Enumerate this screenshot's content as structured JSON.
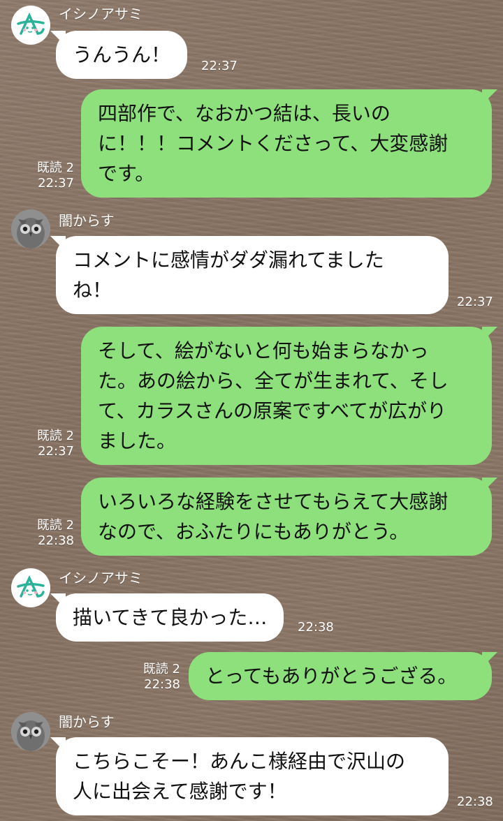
{
  "icons": {
    "avatar_ishino": "letter-a-face-avatar-icon",
    "avatar_karasu": "owl-photo-avatar-icon"
  },
  "colors": {
    "outgoing_bubble": "#8de07b",
    "incoming_bubble": "#ffffff",
    "background": "#857060"
  },
  "messages": [
    {
      "direction": "in",
      "sender": "イシノアサミ",
      "text": "うんうん！",
      "time": "22:37"
    },
    {
      "direction": "out",
      "read": "既読 2",
      "text": "四部作で、なおかつ結は、長いの\nに！！！コメントくださって、大変感謝\nです。",
      "time": "22:37"
    },
    {
      "direction": "in",
      "sender": "闇からす",
      "text": "コメントに感情がダダ漏れてました\nね！",
      "time": "22:37"
    },
    {
      "direction": "out",
      "read": "既読 2",
      "text": "そして、絵がないと何も始まらなかっ\nた。あの絵から、全てが生まれて、そし\nて、カラスさんの原案ですべてが広がり\nました。",
      "time": "22:37"
    },
    {
      "direction": "out",
      "read": "既読 2",
      "text": "いろいろな経験をさせてもらえて大感謝\nなので、おふたりにもありがとう。",
      "time": "22:38"
    },
    {
      "direction": "in",
      "sender": "イシノアサミ",
      "text": "描いてきて良かった…",
      "time": "22:38"
    },
    {
      "direction": "out",
      "read": "既読 2",
      "text": "とってもありがとうござる。",
      "time": "22:38"
    },
    {
      "direction": "in",
      "sender": "闇からす",
      "text": "こちらこそー！あんこ様経由で沢山の\n人に出会えて感謝です！",
      "time": "22:38"
    }
  ]
}
